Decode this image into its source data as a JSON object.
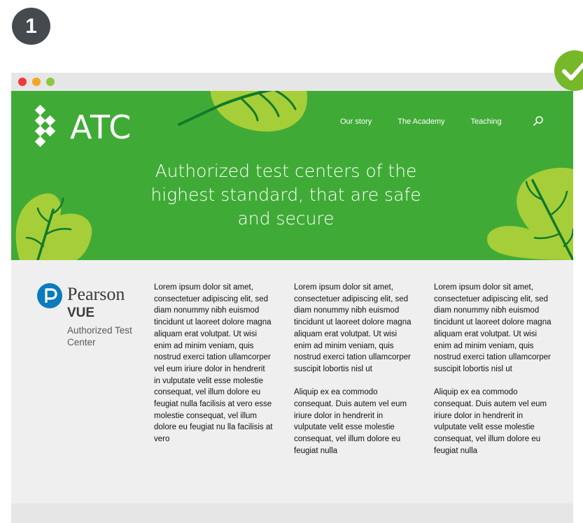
{
  "step": {
    "number": "1"
  },
  "colors": {
    "hero_green": "#3fab36",
    "leaf_lime": "#a6ce39",
    "leaf_dark": "#0f7a2b",
    "check_green": "#77b82a",
    "badge_gray": "#454a4f"
  },
  "site": {
    "logo_text": "ATC",
    "nav": [
      "Our story",
      "The Academy",
      "Teaching"
    ],
    "headline": "Authorized test centers of the highest standard, that are safe and secure"
  },
  "pearson": {
    "brand": "Pearson",
    "product": "VUE",
    "subtitle": "Authorized Test Center"
  },
  "columns": [
    {
      "paragraphs": [
        "Lorem ipsum dolor sit amet, consectetuer adipiscing elit, sed diam nonummy nibh euismod tincidunt ut laoreet dolore magna aliquam erat volutpat. Ut wisi enim ad minim veniam, quis nostrud exerci tation ullamcorper vel eum iriure dolor in hendrerit in vulputate velit esse molestie consequat, vel illum dolore eu feugiat nulla facilisis at vero esse molestie consequat, vel illum dolore eu feugiat nu lla facilisis at vero"
      ]
    },
    {
      "paragraphs": [
        "Lorem ipsum dolor sit amet, consectetuer adipiscing elit, sed diam nonummy nibh euismod tincidunt ut laoreet dolore magna aliquam erat volutpat. Ut wisi enim ad minim veniam, quis nostrud exerci tation ullamcorper suscipit lobortis nisl ut",
        "Aliquip ex ea commodo consequat. Duis autem vel eum iriure dolor in hendrerit in vulputate velit esse molestie consequat, vel illum dolore eu feugiat nulla"
      ]
    },
    {
      "paragraphs": [
        "Lorem ipsum dolor sit amet, consectetuer adipiscing elit, sed diam nonummy nibh euismod tincidunt ut laoreet dolore magna aliquam erat volutpat. Ut wisi enim ad minim veniam, quis nostrud exerci tation ullamcorper suscipit lobortis nisl ut",
        "Aliquip ex ea commodo consequat. Duis autem vel eum iriure dolor in hendrerit in vulputate velit esse molestie consequat, vel illum dolore eu feugiat nulla"
      ]
    }
  ],
  "icons": [
    "window-close-dot",
    "window-minimize-dot",
    "window-maximize-dot",
    "atc-diamond-logo-icon",
    "search-icon",
    "pearson-p-logo-icon",
    "checkmark-icon",
    "leaf-illustration"
  ]
}
